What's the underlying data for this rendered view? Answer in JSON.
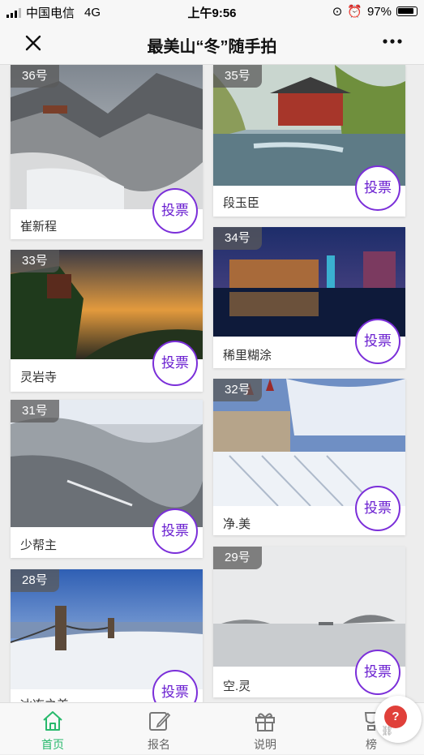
{
  "status_bar": {
    "carrier": "中国电信",
    "network": "4G",
    "time": "上午9:56",
    "battery": "97%"
  },
  "header": {
    "title": "最美山“冬”随手拍",
    "close_icon": "close-icon",
    "more_icon": "more-icon"
  },
  "entries": [
    {
      "number": "36号",
      "author": "崔新程",
      "vote_label": "投票"
    },
    {
      "number": "35号",
      "author": "段玉臣",
      "vote_label": "投票"
    },
    {
      "number": "33号",
      "author": "灵岩寺",
      "vote_label": "投票"
    },
    {
      "number": "34号",
      "author": "稀里糊涂",
      "vote_label": "投票"
    },
    {
      "number": "31号",
      "author": "少帮主",
      "vote_label": "投票"
    },
    {
      "number": "32号",
      "author": "净.美",
      "vote_label": "投票"
    },
    {
      "number": "28号",
      "author": "冰冻之美",
      "vote_label": "投票"
    },
    {
      "number": "29号",
      "author": "空.灵",
      "vote_label": "投票"
    }
  ],
  "tabbar": {
    "home": "首页",
    "signup": "报名",
    "info": "说明",
    "ranking": "榜"
  },
  "colors": {
    "accent": "#7b2fd9",
    "active_tab": "#28b96c"
  }
}
